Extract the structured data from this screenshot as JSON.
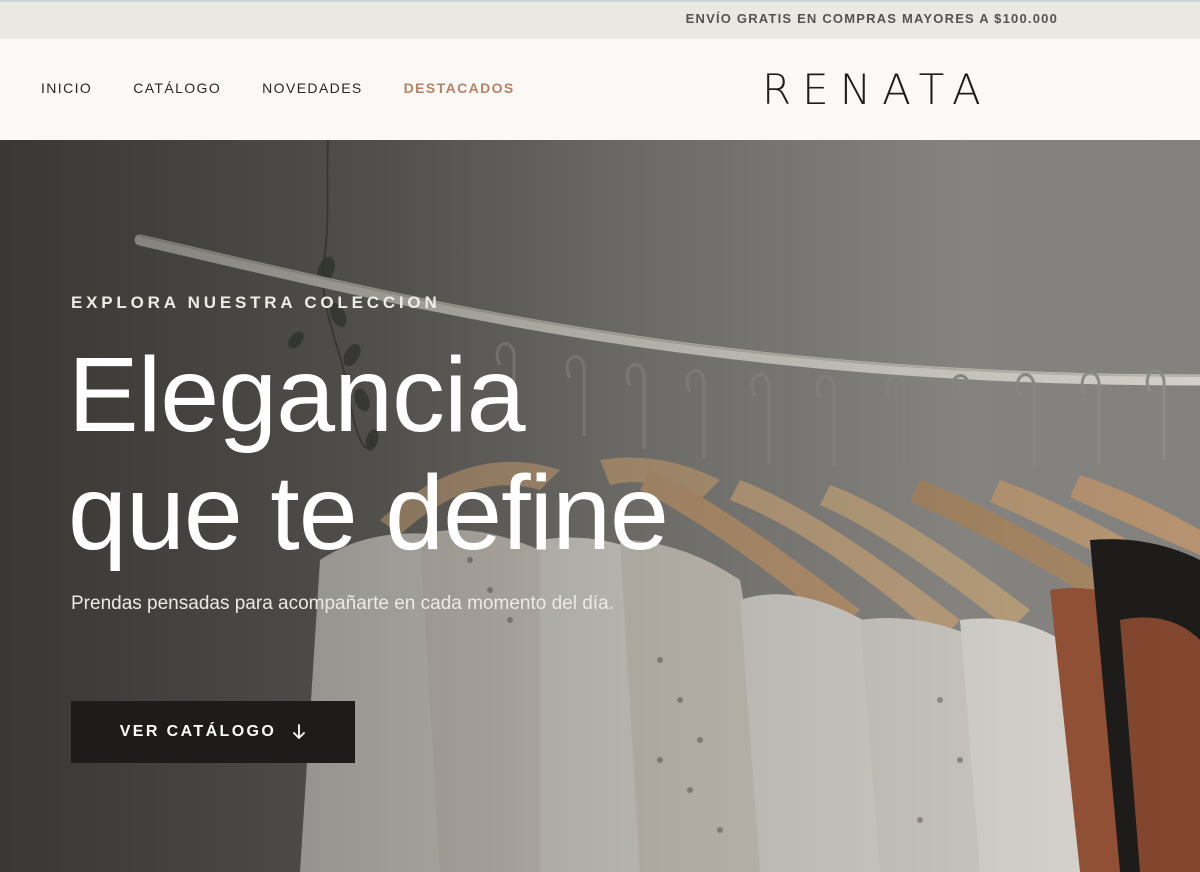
{
  "topbar": {
    "promo": "ENVÍO GRATIS EN COMPRAS MAYORES A $100.000"
  },
  "header": {
    "nav": [
      {
        "label": "INICIO"
      },
      {
        "label": "CATÁLOGO"
      },
      {
        "label": "NOVEDADES"
      },
      {
        "label": "DESTACADOS",
        "active": true
      }
    ],
    "logo": "RENATA"
  },
  "hero": {
    "eyebrow": "EXPLORA NUESTRA COLECCION",
    "headline_line1": "Elegancia",
    "headline_line2": "que te define",
    "subtitle": "Prendas pensadas para acompañarte en cada momento del día.",
    "cta_label": "VER CATÁLOGO",
    "cta_icon": "arrow-down-icon",
    "image": "clothing-rack-photo"
  },
  "colors": {
    "accent": "#b88163",
    "topbar_bg": "#e9e8e3",
    "header_bg": "#faf9f5",
    "cta_bg": "#1d1c1b"
  }
}
